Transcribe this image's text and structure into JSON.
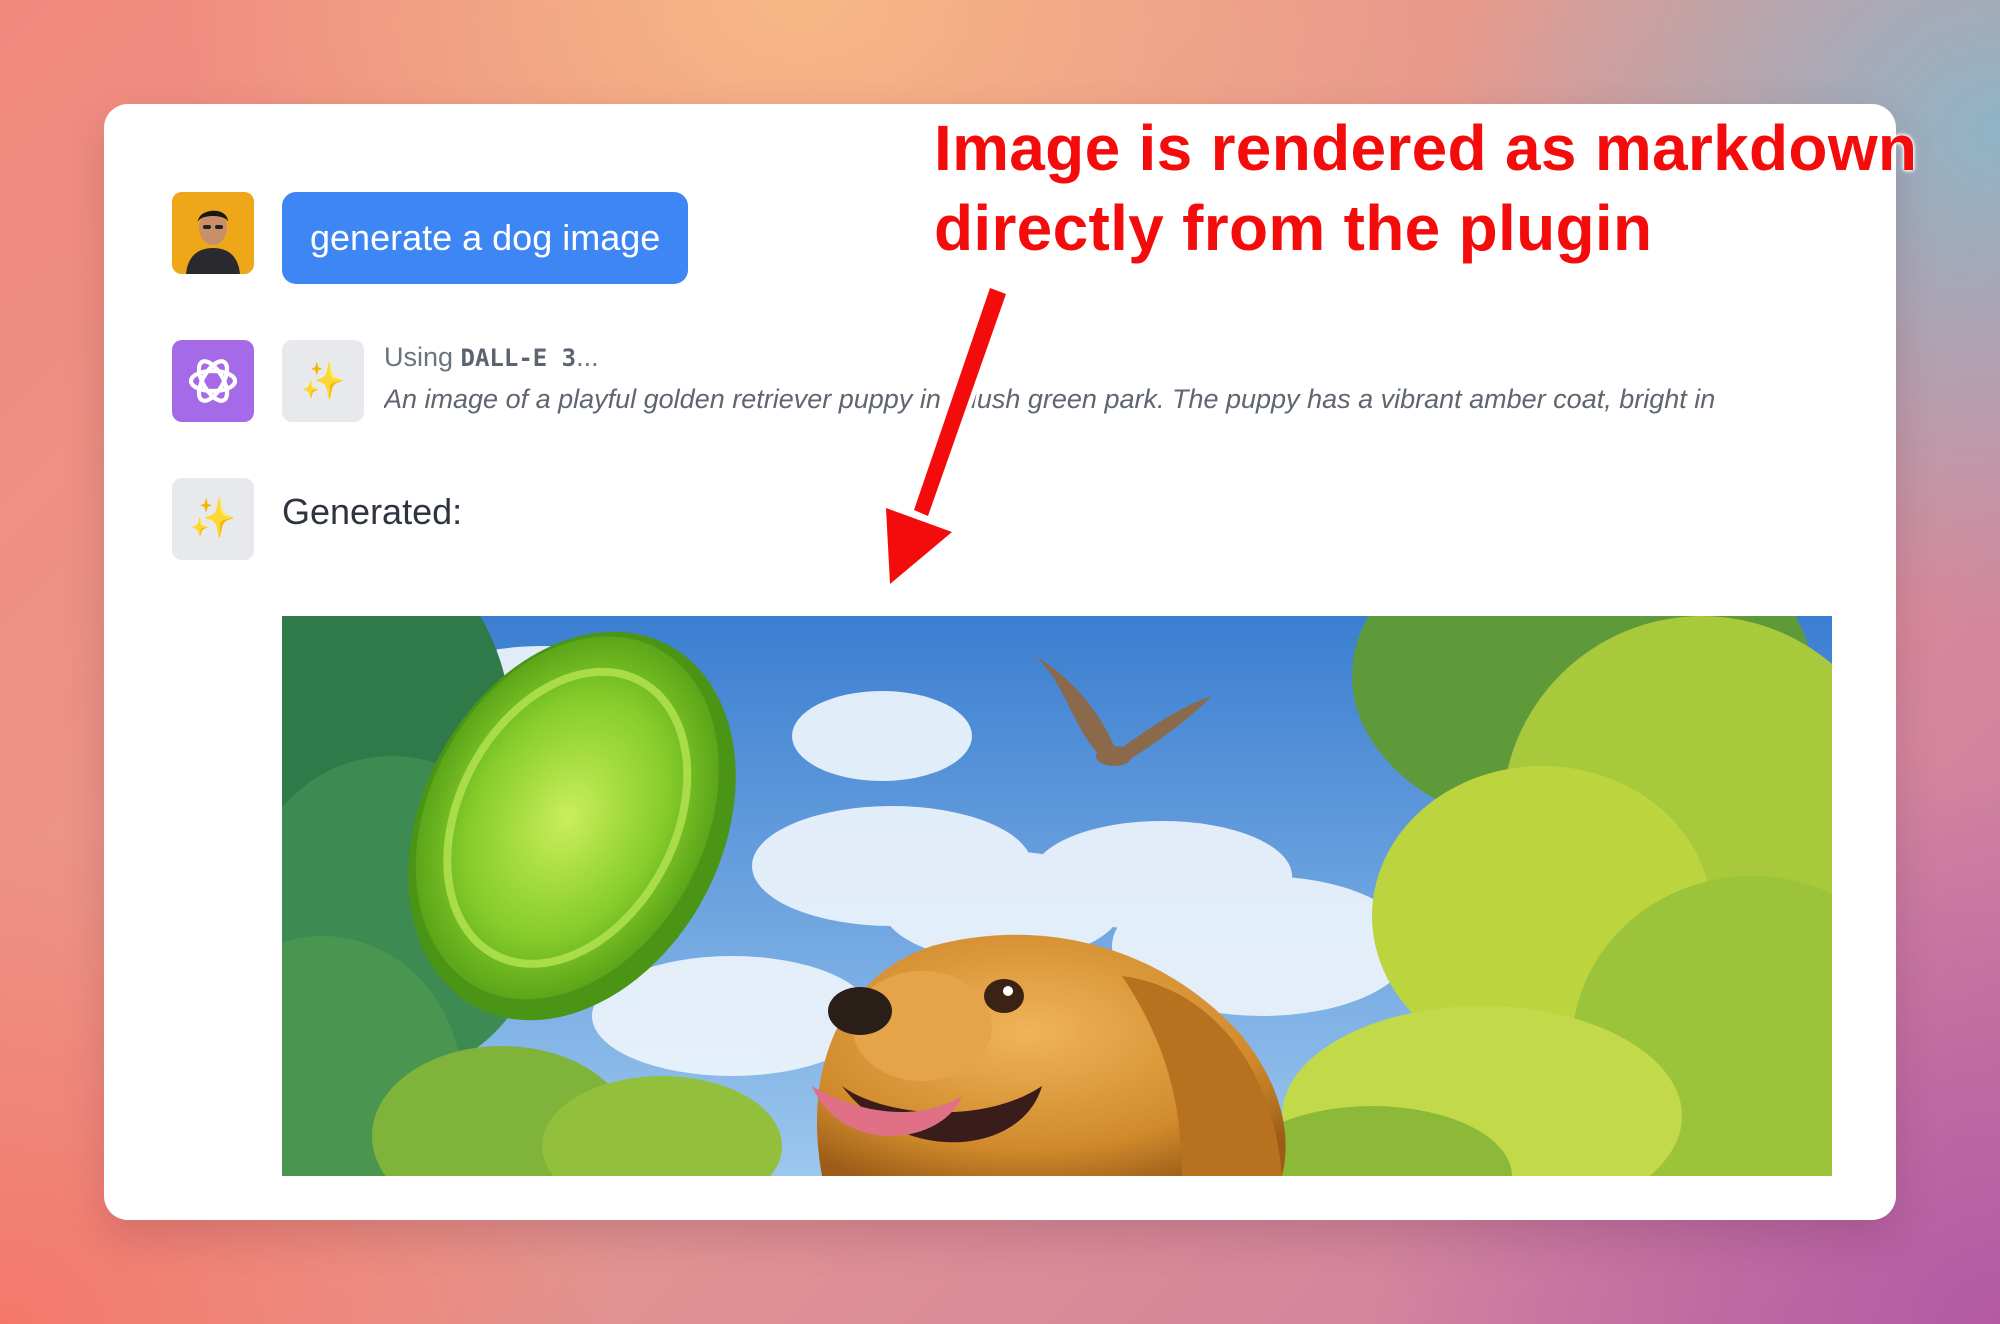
{
  "user_message": {
    "text": "generate a dog image"
  },
  "tool_call": {
    "using_prefix": "Using ",
    "tool_name": "DALL-E 3",
    "using_suffix": "...",
    "prompt_preview": "An image of a playful golden retriever puppy in a lush green park. The puppy has a vibrant amber coat, bright in"
  },
  "result": {
    "label": "Generated:"
  },
  "annotation": {
    "line1": "Image is rendered as markdown",
    "line2": "directly from the plugin",
    "color": "#f40b0b"
  },
  "icons": {
    "user_avatar": "user-photo-avatar",
    "assistant_avatar": "openai-logo-icon",
    "tool_icon": "sparkles-icon",
    "result_icon": "sparkles-icon"
  },
  "colors": {
    "user_bubble": "#3e86f4",
    "assistant_avatar_bg": "#a56ae8"
  }
}
